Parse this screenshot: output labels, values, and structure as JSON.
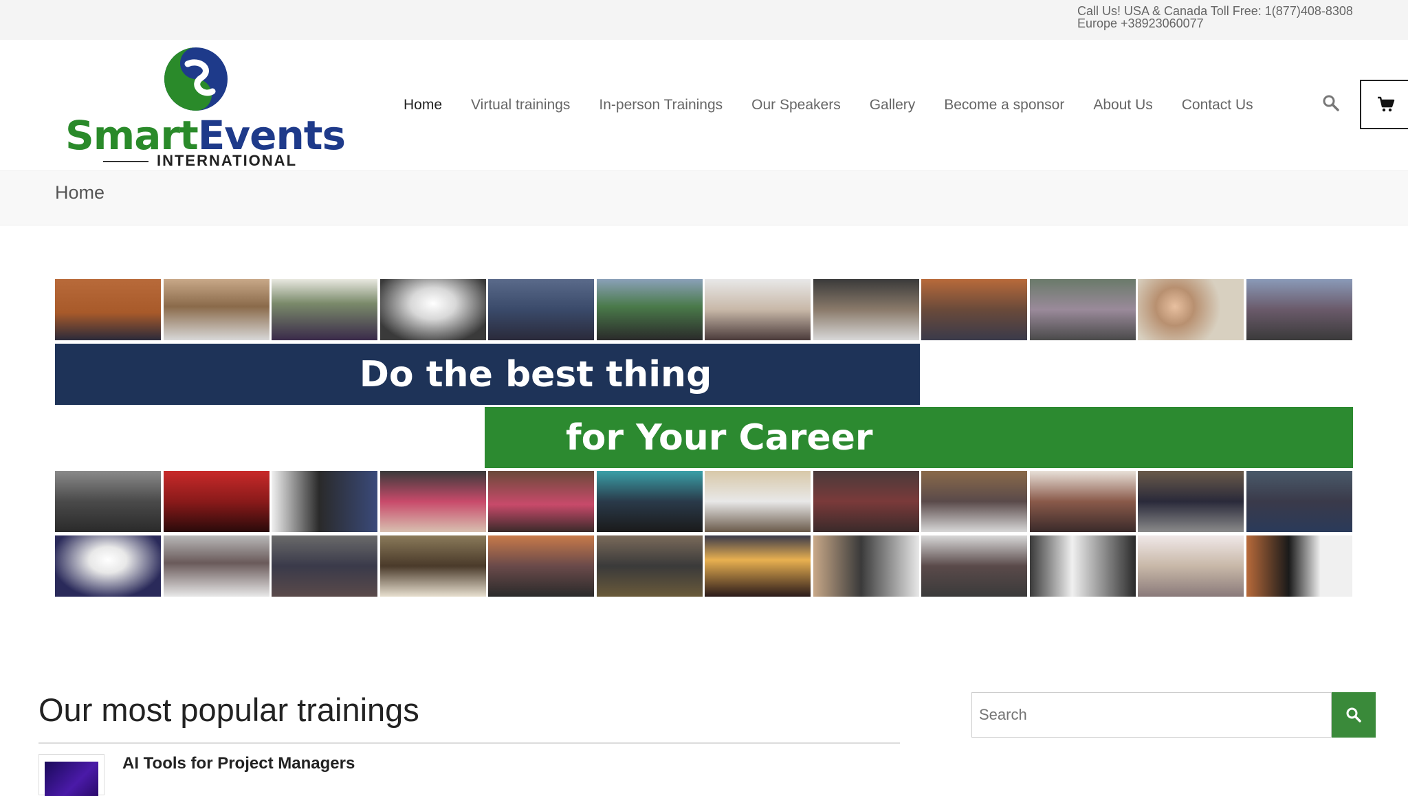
{
  "topbar": {
    "phone_line1": "Call Us! USA & Canada Toll Free: 1(877)408-8308",
    "phone_line2": "Europe +38923060077"
  },
  "logo": {
    "name_part1": "Smart",
    "name_part2": "Events",
    "subtitle": "INTERNATIONAL"
  },
  "nav": {
    "items": [
      {
        "label": "Home"
      },
      {
        "label": "Virtual trainings"
      },
      {
        "label": "In-person Trainings"
      },
      {
        "label": "Our Speakers"
      },
      {
        "label": "Gallery"
      },
      {
        "label": "Become a sponsor"
      },
      {
        "label": "About Us"
      },
      {
        "label": "Contact Us"
      }
    ],
    "active_index": 0,
    "search_icon": "search-icon",
    "cart_icon": "cart-icon"
  },
  "breadcrumb": {
    "title": "Home"
  },
  "banner": {
    "line1": "Do the best thing",
    "line2": "for Your Career"
  },
  "popular": {
    "title": "Our most popular trainings",
    "items": [
      {
        "name": "AI Tools for Project Managers"
      }
    ]
  },
  "sidebar_search": {
    "placeholder": "Search",
    "button_icon": "search-icon"
  },
  "colors": {
    "brand_green": "#2c8a30",
    "brand_navy": "#1e3358",
    "search_button": "#3a8a3a"
  }
}
